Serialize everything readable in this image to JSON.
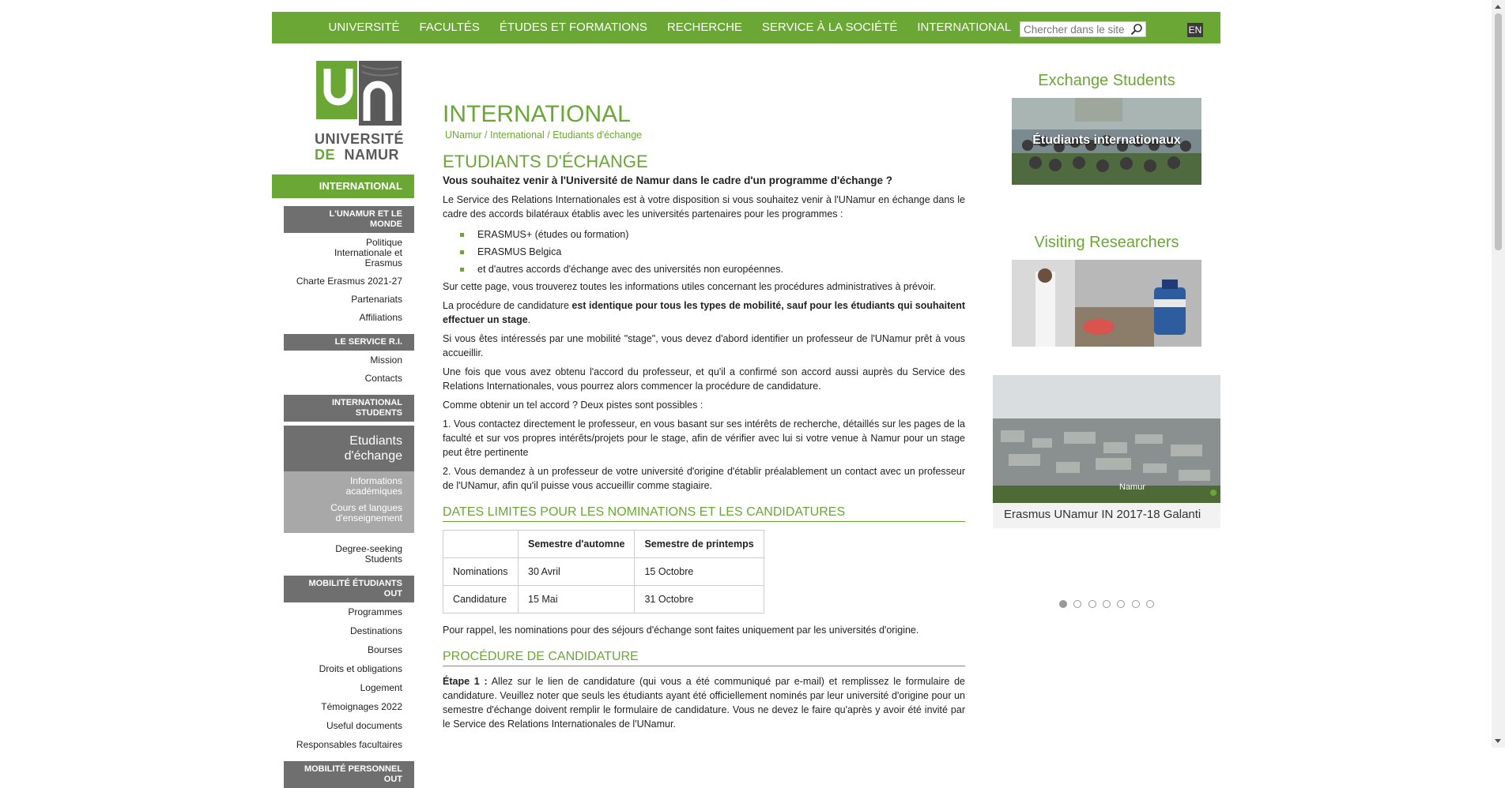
{
  "topnav": {
    "items": [
      "UNIVERSITÉ",
      "FACULTÉS",
      "ÉTUDES ET FORMATIONS",
      "RECHERCHE",
      "SERVICE À LA SOCIÉTÉ",
      "INTERNATIONAL"
    ],
    "search_placeholder": "Chercher dans le site",
    "lang": "EN"
  },
  "logo": {
    "line1": "UNIVERSITÉ",
    "line2a": "DE",
    "line2b": "NAMUR",
    "brand_green": "#6aa735"
  },
  "sidebar": {
    "section_title": "INTERNATIONAL",
    "groups": [
      {
        "title": "L'UNAMUR ET LE MONDE",
        "links": [
          "Politique Internationale et Erasmus",
          "Charte Erasmus 2021-27",
          "Partenariats",
          "Affiliations"
        ]
      },
      {
        "title": "LE SERVICE R.I.",
        "links": [
          "Mission",
          "Contacts"
        ]
      },
      {
        "title": "INTERNATIONAL STUDENTS",
        "links": []
      }
    ],
    "active": "Etudiants d'échange",
    "active_sub": [
      "Informations académiques",
      "Cours et langues d'enseignement"
    ],
    "after_active": [
      "Degree-seeking Students"
    ],
    "groups2": [
      {
        "title": "MOBILITÉ ÉTUDIANTS OUT",
        "links": [
          "Programmes",
          "Destinations",
          "Bourses",
          "Droits et obligations",
          "Logement",
          "Témoignages 2022",
          "Useful documents",
          "Responsables facultaires"
        ]
      },
      {
        "title": "MOBILITÉ PERSONNEL OUT",
        "links": []
      }
    ]
  },
  "main": {
    "title": "INTERNATIONAL",
    "breadcrumb": [
      "UNamur",
      "International",
      "Etudiants d'échange"
    ],
    "breadcrumb_sep": " / ",
    "h2": "ETUDIANTS D'ÉCHANGE",
    "intro_bold": "Vous souhaitez venir à l'Université de Namur dans le cadre d'un programme d'échange ?",
    "p1": "Le Service des Relations Internationales est à votre disposition si vous souhaitez venir à l'UNamur en échange dans le cadre des accords bilatéraux établis avec les universités partenaires pour les programmes :",
    "programs": [
      "ERASMUS+ (études ou formation)",
      "ERASMUS Belgica",
      "et d'autres accords d'échange avec des universités non européennes."
    ],
    "p2": "Sur cette page, vous trouverez toutes les informations utiles concernant les procédures administratives à prévoir.",
    "p3a": "La procédure de candidature ",
    "p3b": "est identique pour tous les types de mobilité, sauf pour les étudiants qui souhaitent effectuer un stage",
    "p3c": ".",
    "p4": "Si vous êtes intéressés par une mobilité \"stage\", vous devez d'abord identifier un professeur de l'UNamur prêt à vous accueillir.",
    "p5": "Une fois que vous avez obtenu l'accord du professeur, et qu'il a confirmé son accord aussi auprès du Service des Relations Internationales, vous pourrez alors commencer la procédure de candidature.",
    "p6": "Comme obtenir un tel accord ? Deux pistes sont possibles :",
    "p7": "1. Vous contactez directement le professeur, en vous basant sur ses intérêts de recherche, détaillés sur les pages de la faculté et sur vos propres intérêts/projets pour le stage, afin de vérifier avec lui si votre venue à Namur pour un stage peut être pertinente",
    "p8": "2. Vous demandez à un professeur de votre université d'origine d'établir préalablement un contact avec un professeur de l'UNamur, afin qu'il puisse vous accueillir comme stagiaire.",
    "h3_dates": "DATES LIMITES POUR LES NOMINATIONS ET LES CANDIDATURES",
    "table": {
      "headers": [
        "",
        "Semestre d'automne",
        "Semestre de printemps"
      ],
      "rows": [
        [
          "Nominations",
          "30 Avril",
          "15 Octobre"
        ],
        [
          "Candidature",
          "15 Mai",
          "31 Octobre"
        ]
      ]
    },
    "p9": "Pour rappel, les nominations pour des séjours d'échange sont faites uniquement par les universités d'origine.",
    "h3_proc": "PROCÉDURE DE CANDIDATURE",
    "step1_label": "Étape 1 :",
    "step1": " Allez sur le lien de candidature (qui vous a été communiqué par e-mail) et remplissez le formulaire de candidature. Veuillez noter que seuls les étudiants ayant été officiellement nominés par leur université d'origine pour un semestre d'échange doivent remplir le formulaire de candidature. Vous ne devez le faire qu'après y avoir été invité par le Service des Relations Internationales de l'UNamur."
  },
  "right": {
    "block1_title": "Exchange Students",
    "block1_overlay": "Étudiants internationaux",
    "block2_title": "Visiting Researchers",
    "video_overlay": "Namur",
    "video_caption": "Erasmus UNamur IN 2017-18 Galanti",
    "dots_count": 7
  }
}
